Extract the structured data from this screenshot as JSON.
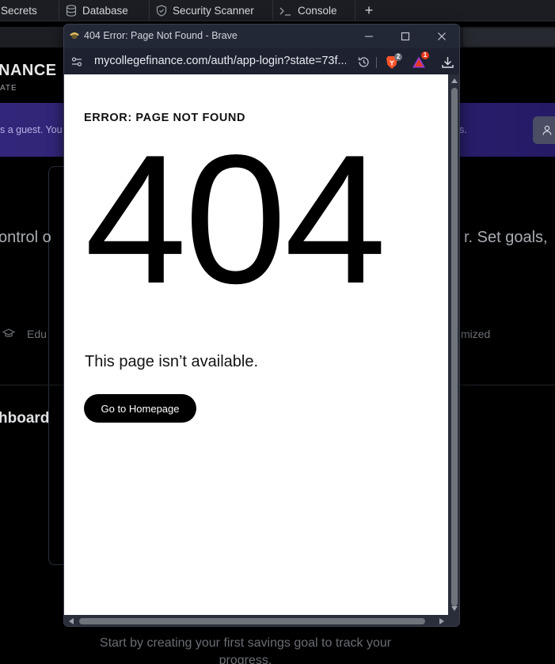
{
  "ide_tabs": [
    {
      "label": "Secrets",
      "icon": "lock-icon"
    },
    {
      "label": "Database",
      "icon": "database-icon"
    },
    {
      "label": "Security Scanner",
      "icon": "shield-icon"
    },
    {
      "label": "Console",
      "icon": "terminal-icon"
    }
  ],
  "ide_add_tab": "+",
  "background_app": {
    "logo": "NANCE",
    "logo_sub": "ATE",
    "banner_left": "s a guest. You",
    "banner_right": "s.",
    "line_left": "ontrol o",
    "line_right": "r. Set goals,",
    "feature_left": "Edu",
    "feature_right": "mized",
    "dashboard_heading": "hboard",
    "empty_state": "Start by creating your first savings goal to track your progress."
  },
  "popup": {
    "window_title": "404 Error: Page Not Found - Brave",
    "url": "mycollegefinance.com/auth/app-login?state=73f...",
    "shields_badge": "2",
    "rewards_badge": "1",
    "page": {
      "error_label": "ERROR: PAGE NOT FOUND",
      "code": "404",
      "message": "This page isn’t available.",
      "button": "Go to Homepage"
    }
  },
  "colors": {
    "banner": "#32267a",
    "brave_orange": "#fb542b",
    "rewards_red": "#e5391d",
    "popup_chrome": "#232837",
    "page_bg": "#ffffff",
    "button_bg": "#000000"
  }
}
